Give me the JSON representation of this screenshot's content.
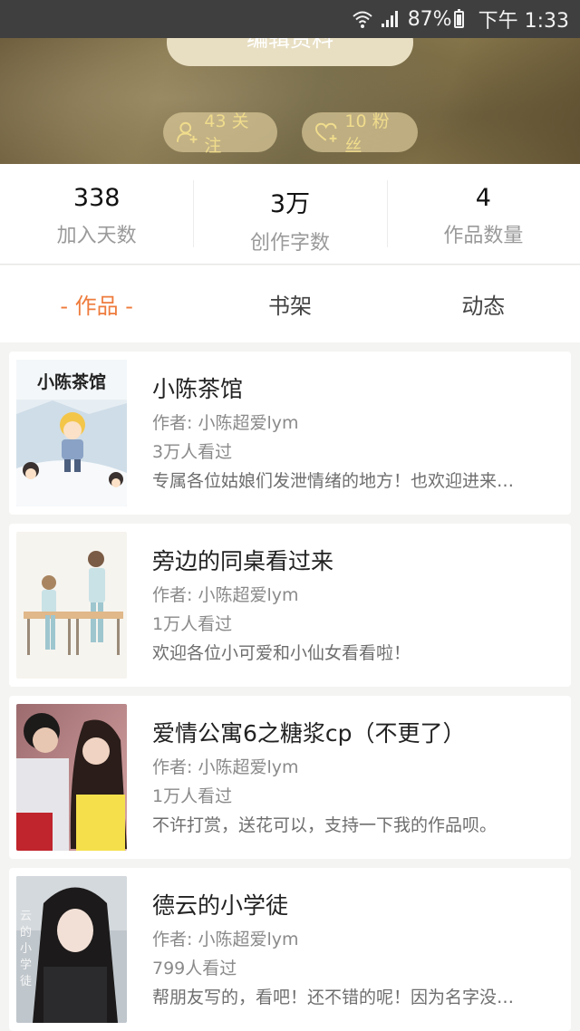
{
  "status_bar": {
    "battery_percent": "87%",
    "time": "下午 1:33",
    "icons": [
      "wifi-icon",
      "signal-icon",
      "battery-icon"
    ]
  },
  "header": {
    "edit_profile_label": "编辑资料",
    "following": "43 关注",
    "fans": "10 粉丝"
  },
  "stats": [
    {
      "value": "338",
      "label": "加入天数"
    },
    {
      "value": "3万",
      "label": "创作字数"
    },
    {
      "value": "4",
      "label": "作品数量"
    }
  ],
  "tabs": [
    {
      "label": "- 作品 -",
      "active": true
    },
    {
      "label": "书架",
      "active": false
    },
    {
      "label": "动态",
      "active": false
    }
  ],
  "works": [
    {
      "title": "小陈茶馆",
      "author": "作者: 小陈超爱lym",
      "views": "3万人看过",
      "description": "专属各位姑娘们发泄情绪的地方！也欢迎进来…",
      "cover_text": "小陈茶馆"
    },
    {
      "title": "旁边的同桌看过来",
      "author": "作者: 小陈超爱lym",
      "views": "1万人看过",
      "description": "欢迎各位小可爱和小仙女看看啦！"
    },
    {
      "title": "爱情公寓6之糖浆cp（不更了）",
      "author": "作者: 小陈超爱lym",
      "views": "1万人看过",
      "description": "不许打赏，送花可以，支持一下我的作品呗。"
    },
    {
      "title": "德云的小学徒",
      "author": "作者: 小陈超爱lym",
      "views": "799人看过",
      "description": "帮朋友写的，看吧！还不错的呢！因为名字没…",
      "cover_text": "云的小学徒"
    }
  ],
  "colors": {
    "accent": "#ee7b3c",
    "pill_text": "#f0dc8c"
  }
}
